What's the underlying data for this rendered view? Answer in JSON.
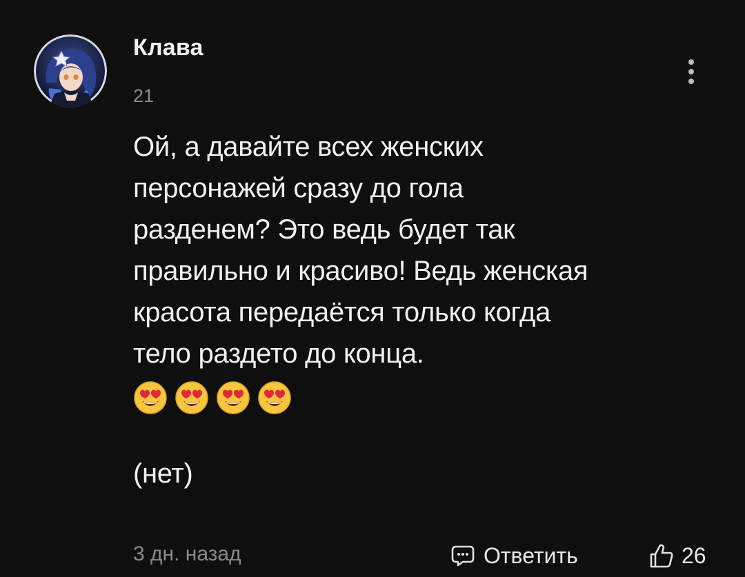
{
  "comment": {
    "author": "Клава",
    "level": "21",
    "text_lines": [
      "Ой, а давайте всех женских",
      "персонажей сразу до гола",
      "разденем? Это ведь будет так",
      "правильно и красиво! Ведь женская",
      "красота передаётся только когда",
      "тело раздето до конца."
    ],
    "emoji": [
      "😍",
      "😍",
      "😍",
      "😍"
    ],
    "postscript": "(нет)",
    "time": "3 дн. назад",
    "reply_label": "Ответить",
    "likes": "26"
  },
  "icons": {
    "more": "vertical-dots-icon",
    "reply": "chat-bubble-icon",
    "like": "thumbs-up-icon",
    "avatar": "anime-character-avatar",
    "emoji": "heart-eyes-emoji"
  },
  "colors": {
    "background": "#0f0f10",
    "text": "#f1f1f1",
    "muted": "#8c8c8c"
  }
}
